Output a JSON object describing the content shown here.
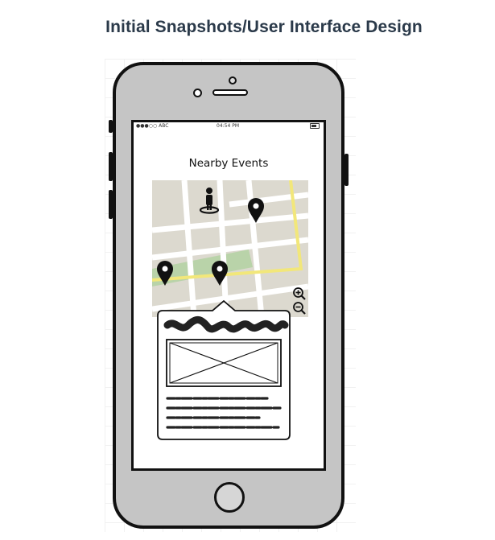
{
  "slide": {
    "title": "Initial Snapshots/User Interface Design"
  },
  "status_bar": {
    "carrier": "●●●○○ ABC",
    "time": "04:54 PM",
    "icon": "battery-icon"
  },
  "screen": {
    "title": "Nearby Events"
  },
  "map": {
    "icons": [
      "person-icon",
      "map-pin-icon",
      "zoom-in-icon",
      "zoom-out-icon"
    ],
    "pin_count": 3,
    "colors": {
      "land": "#dcd9cf",
      "roads": "#ffffff",
      "park": "#b9d3a9",
      "highway": "#f2e77a",
      "pin": "#111111"
    }
  },
  "popup": {
    "icons": [
      "image-placeholder-icon"
    ]
  },
  "colors": {
    "title": "#2b3a4a",
    "phone_body": "#c5c5c5",
    "outline": "#111111"
  }
}
